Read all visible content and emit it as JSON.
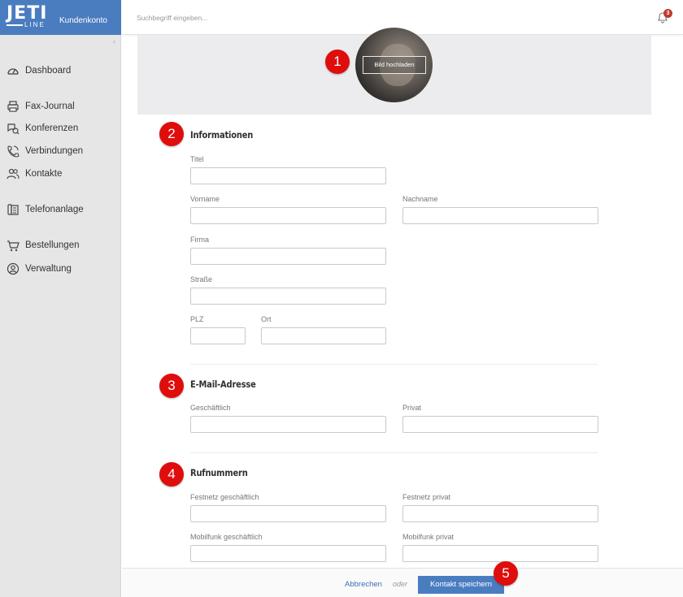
{
  "brand": {
    "logo_text": "JETI",
    "logo_sub": "LINE",
    "account_label": "Kundenkonto",
    "color": "#4a7cc0"
  },
  "search": {
    "placeholder": "Suchbegriff eingeben..."
  },
  "notifications": {
    "count": "3",
    "icon": "bell-icon"
  },
  "sidebar": {
    "collapse_glyph": "‹",
    "items": [
      {
        "label": "Dashboard",
        "icon": "gauge-icon"
      },
      {
        "label": "Fax-Journal",
        "icon": "printer-icon"
      },
      {
        "label": "Konferenzen",
        "icon": "conference-icon"
      },
      {
        "label": "Verbindungen",
        "icon": "phone-icon"
      },
      {
        "label": "Kontakte",
        "icon": "contacts-icon"
      },
      {
        "label": "Telefonanlage",
        "icon": "pbx-icon"
      },
      {
        "label": "Bestellungen",
        "icon": "cart-icon"
      },
      {
        "label": "Verwaltung",
        "icon": "user-circle-icon"
      }
    ]
  },
  "photo": {
    "upload_label": "Bild hochladen"
  },
  "markers": [
    "1",
    "2",
    "3",
    "4",
    "5"
  ],
  "sections": {
    "info": {
      "title": "Informationen",
      "titel_label": "Titel",
      "titel_value": "",
      "vorname_label": "Vorname",
      "vorname_value": "",
      "nachname_label": "Nachname",
      "nachname_value": "",
      "firma_label": "Firma",
      "firma_value": "",
      "strasse_label": "Straße",
      "strasse_value": "",
      "plz_label": "PLZ",
      "plz_value": "",
      "ort_label": "Ort",
      "ort_value": ""
    },
    "email": {
      "title": "E-Mail-Adresse",
      "business_label": "Geschäftlich",
      "business_value": "",
      "private_label": "Privat",
      "private_value": ""
    },
    "phone": {
      "title": "Rufnummern",
      "landline_business_label": "Festnetz geschäftlich",
      "landline_business_value": "",
      "landline_private_label": "Festnetz privat",
      "landline_private_value": "",
      "mobile_business_label": "Mobilfunk geschäftlich",
      "mobile_business_value": "",
      "mobile_private_label": "Mobilfunk privat",
      "mobile_private_value": ""
    }
  },
  "footer": {
    "cancel_label": "Abbrechen",
    "or_label": "oder",
    "save_label": "Kontakt speichern"
  }
}
